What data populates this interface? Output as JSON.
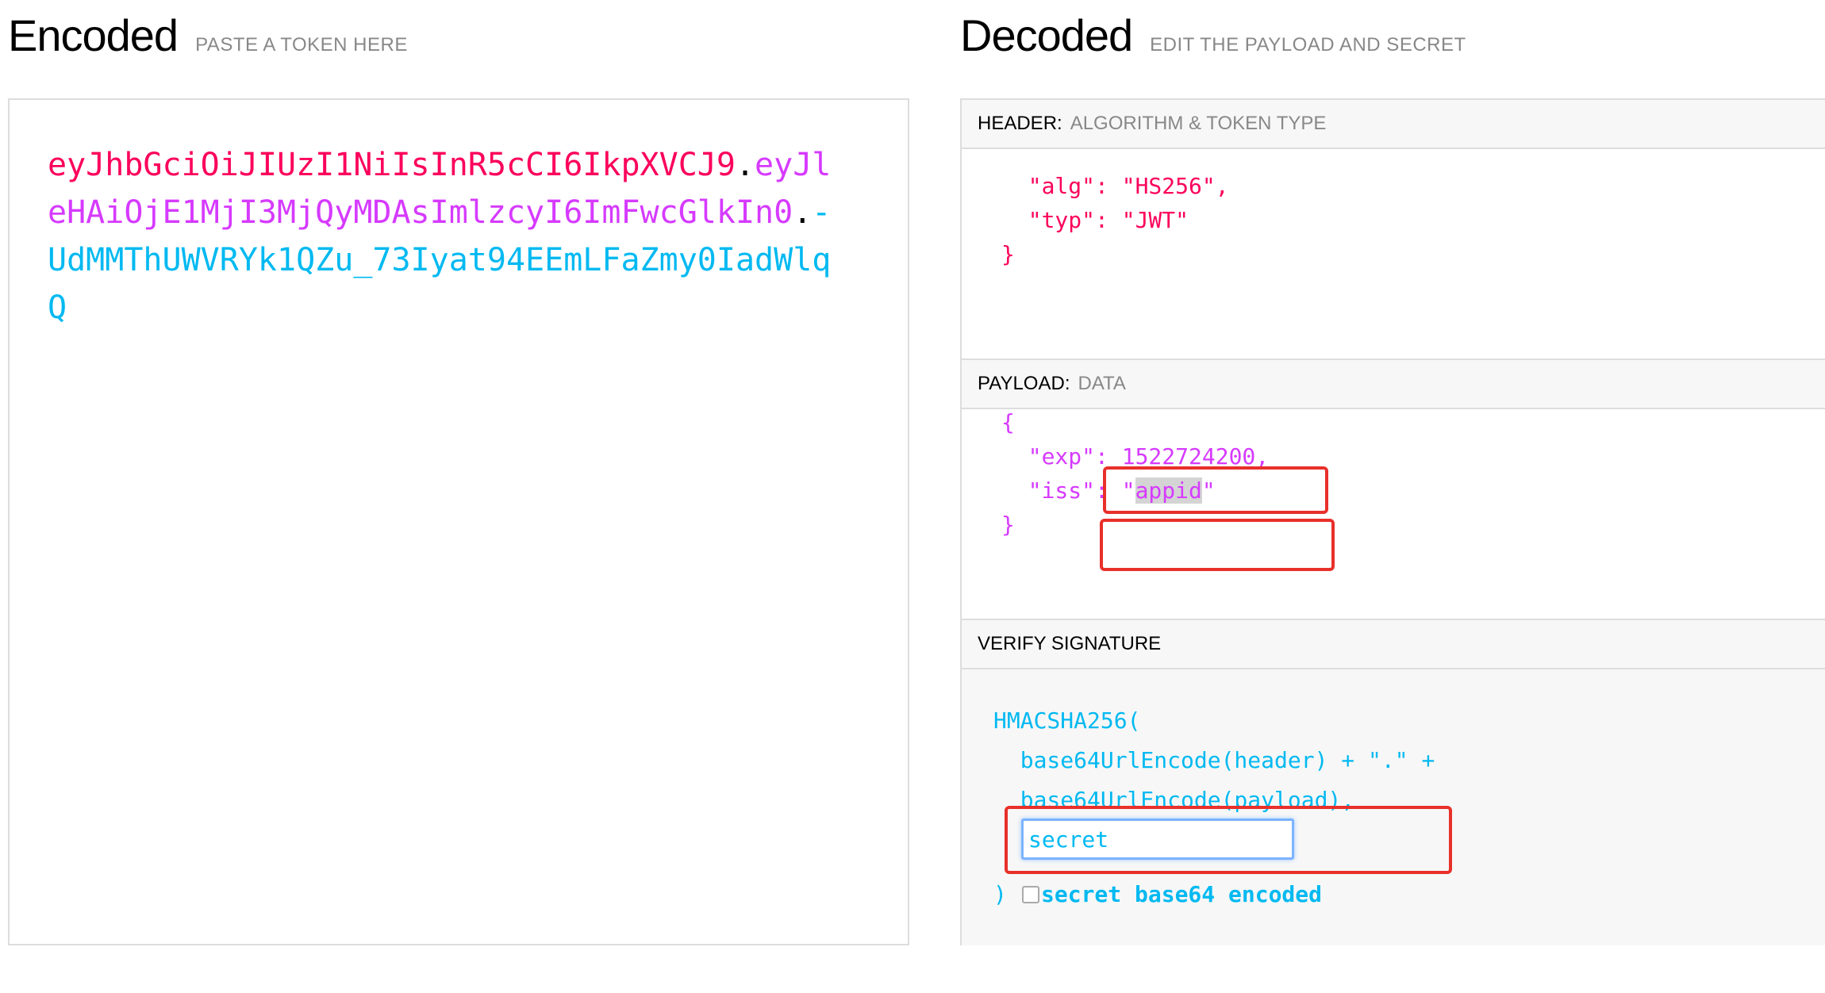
{
  "encoded": {
    "title": "Encoded",
    "subtitle": "PASTE A TOKEN HERE",
    "token": {
      "header": "eyJhbGciOiJIUzI1NiIsInR5cCI6IkpXVCJ9",
      "dot1": ".",
      "payload": "eyJleHAiOjE1MjI3MjQyMDAsImlzcyI6ImFwcGlkIn0",
      "dot2": ".",
      "signature": "-UdMMThUWVRYk1QZu_73Iyat94EEmLFaZmy0IadWlqQ"
    }
  },
  "decoded": {
    "title": "Decoded",
    "subtitle": "EDIT THE PAYLOAD AND SECRET",
    "header_section": {
      "label": "HEADER:",
      "muted": "ALGORITHM & TOKEN TYPE",
      "lines": [
        "  \"alg\": \"HS256\",",
        "  \"typ\": \"JWT\"",
        "}"
      ]
    },
    "payload_section": {
      "label": "PAYLOAD:",
      "muted": "DATA",
      "open": "{",
      "exp_key": "  \"exp\": ",
      "exp_value": "1522724200,",
      "iss_key": "  \"iss\": ",
      "iss_q1": "\"",
      "iss_value": "appid",
      "iss_q2": "\"",
      "close": "}"
    },
    "verify_section": {
      "label": "VERIFY SIGNATURE",
      "fn_open": "HMACSHA256(",
      "line2": "  base64UrlEncode(header) + \".\" +",
      "line3": "  base64UrlEncode(payload),",
      "secret_value": "secret",
      "close": ")",
      "checkbox_label": "secret base64 encoded"
    }
  },
  "colors": {
    "header": "#fb015b",
    "payload": "#d63aff",
    "signature": "#00b9f1",
    "annotation": "#e8302a"
  }
}
